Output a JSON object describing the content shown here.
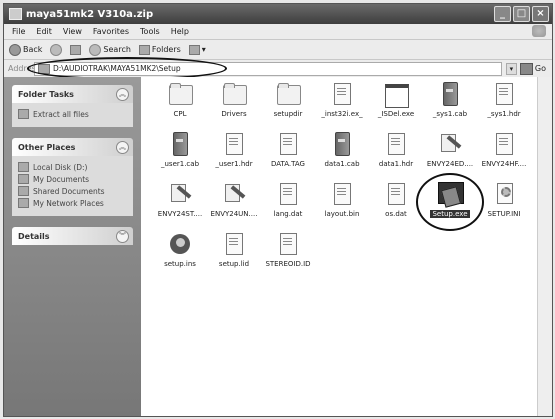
{
  "window": {
    "title": "maya51mk2 V310a.zip",
    "buttons": [
      "_",
      "□",
      "×"
    ]
  },
  "menubar": {
    "items": [
      "File",
      "Edit",
      "View",
      "Favorites",
      "Tools",
      "Help"
    ]
  },
  "toolbar": {
    "back_label": "Back",
    "search_label": "Search",
    "folders_label": "Folders",
    "views_symbol": "▾"
  },
  "address": {
    "label": "Address",
    "path": "D:\\AUDIOTRAK\\MAYA51MK2\\Setup",
    "go_label": "Go"
  },
  "tasks": {
    "folder_tasks": {
      "title": "Folder Tasks",
      "items": [
        "Extract all files"
      ]
    },
    "other_places": {
      "title": "Other Places",
      "items": [
        "Local Disk (D:)",
        "My Documents",
        "Shared Documents",
        "My Network Places"
      ]
    },
    "details": {
      "title": "Details"
    }
  },
  "files": [
    {
      "name": "CPL",
      "icon": "folder-icon"
    },
    {
      "name": "Drivers",
      "icon": "folder-icon"
    },
    {
      "name": "setupdir",
      "icon": "folder-icon"
    },
    {
      "name": "_inst32i.ex_",
      "icon": "document-icon"
    },
    {
      "name": "_ISDel.exe",
      "icon": "window-icon"
    },
    {
      "name": "_sys1.cab",
      "icon": "cabinet-icon"
    },
    {
      "name": "_sys1.hdr",
      "icon": "document-icon"
    },
    {
      "name": "_user1.cab",
      "icon": "cabinet-icon"
    },
    {
      "name": "_user1.hdr",
      "icon": "document-icon"
    },
    {
      "name": "DATA.TAG",
      "icon": "document-icon"
    },
    {
      "name": "data1.cab",
      "icon": "cabinet-icon"
    },
    {
      "name": "data1.hdr",
      "icon": "document-icon"
    },
    {
      "name": "ENVY24ED....",
      "icon": "tool-icon"
    },
    {
      "name": "ENVY24HF....",
      "icon": "document-icon"
    },
    {
      "name": "ENVY24ST....",
      "icon": "tool-icon"
    },
    {
      "name": "ENVY24UN....",
      "icon": "tool-icon"
    },
    {
      "name": "lang.dat",
      "icon": "document-icon"
    },
    {
      "name": "layout.bin",
      "icon": "document-icon"
    },
    {
      "name": "os.dat",
      "icon": "document-icon"
    },
    {
      "name": "Setup.exe",
      "icon": "setup-icon"
    },
    {
      "name": "SETUP.INI",
      "icon": "ini-icon"
    },
    {
      "name": "setup.ins",
      "icon": "installscript-icon"
    },
    {
      "name": "setup.lid",
      "icon": "document-icon"
    },
    {
      "name": "STEREOID.ID",
      "icon": "document-icon"
    }
  ],
  "colors": {
    "titlebar": "#4a4a4a",
    "taskpane": "#8a8a8a"
  }
}
